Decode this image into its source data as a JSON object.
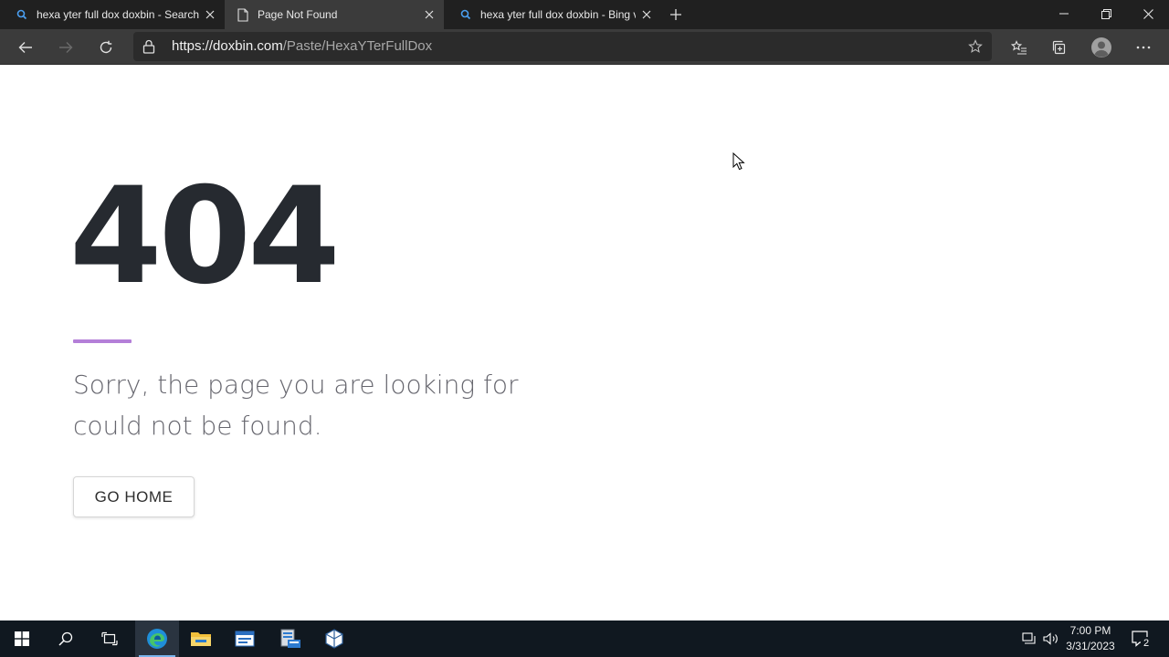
{
  "browser": {
    "tabs": [
      {
        "label": "hexa yter full dox doxbin - Search",
        "icon": "search-icon",
        "active": false
      },
      {
        "label": "Page Not Found",
        "icon": "page-icon",
        "active": true
      },
      {
        "label": "hexa yter full dox doxbin - Bing video",
        "icon": "search-icon",
        "active": false
      }
    ],
    "address": {
      "scheme": "https://",
      "host": "doxbin.com",
      "path": "/Paste/HexaYTerFullDox"
    }
  },
  "page": {
    "error_code": "404",
    "message": "Sorry, the page you are looking for could not be found.",
    "home_button": "GO HOME",
    "accent_color": "#b47fd8"
  },
  "taskbar": {
    "time": "7:00 PM",
    "date": "3/31/2023",
    "notification_count": "2",
    "apps": [
      "start-icon",
      "search-icon",
      "task-view-icon",
      "edge-icon",
      "file-explorer-icon",
      "app-window-icon",
      "server-manager-icon",
      "virtualbox-icon"
    ]
  }
}
